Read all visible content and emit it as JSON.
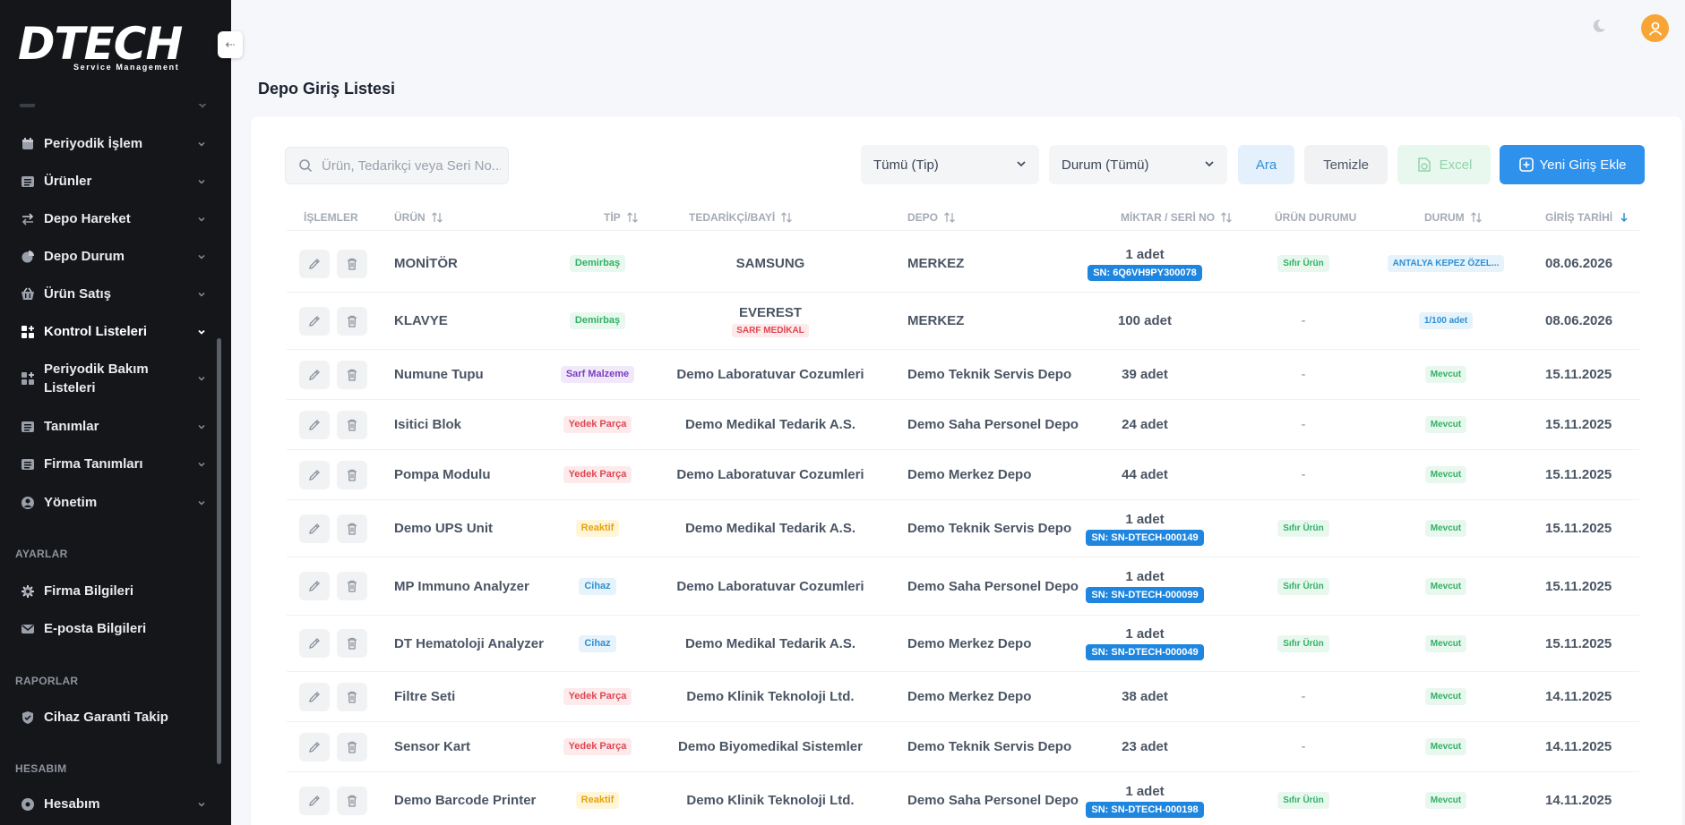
{
  "app": {
    "logo_text": "DTECH",
    "logo_subtitle": "Service Management",
    "collapse_icon": "arrow-left-icon"
  },
  "sidebar": {
    "items": [
      {
        "label": "Periyodik İşlem",
        "icon": "calendar-icon"
      },
      {
        "label": "Ürünler",
        "icon": "list-icon"
      },
      {
        "label": "Depo Hareket",
        "icon": "arrows-exchange-icon"
      },
      {
        "label": "Depo Durum",
        "icon": "pie-chart-icon"
      },
      {
        "label": "Ürün Satış",
        "icon": "basket-icon"
      },
      {
        "label": "Kontrol Listeleri",
        "icon": "grid-plus-icon"
      },
      {
        "label": "Periyodik Bakım Listeleri",
        "icon": "grid-plus-icon"
      },
      {
        "label": "Tanımlar",
        "icon": "list-icon"
      },
      {
        "label": "Firma Tanımları",
        "icon": "list-icon"
      },
      {
        "label": "Yönetim",
        "icon": "user-icon"
      }
    ],
    "section_settings": "AYARLAR",
    "settings_items": [
      {
        "label": "Firma Bilgileri",
        "icon": "gear-icon"
      },
      {
        "label": "E-posta Bilgileri",
        "icon": "mail-icon"
      }
    ],
    "section_reports": "RAPORLAR",
    "reports_items": [
      {
        "label": "Cihaz Garanti Takip",
        "icon": "shield-check-icon"
      }
    ],
    "section_account": "HESABIM",
    "account_items": [
      {
        "label": "Hesabım",
        "icon": "user-circle-icon"
      }
    ]
  },
  "header": {
    "theme_icon": "moon-icon",
    "avatar_icon": "user-avatar-icon"
  },
  "page": {
    "title": "Depo Giriş Listesi"
  },
  "toolbar": {
    "search_placeholder": "Ürün, Tedarikçi veya Seri No...",
    "type_select": "Tümü (Tip)",
    "status_select": "Durum (Tümü)",
    "search_button": "Ara",
    "clear_button": "Temizle",
    "excel_button": "Excel",
    "add_button": "Yeni Giriş Ekle"
  },
  "table": {
    "headers": {
      "actions": "İŞLEMLER",
      "product": "ÜRÜN",
      "type": "TİP",
      "supplier": "TEDARİKÇİ/BAYİ",
      "warehouse": "DEPO",
      "quantity": "MİKTAR / SERİ NO",
      "product_status": "ÜRÜN DURUMU",
      "status": "DURUM",
      "date": "GİRİŞ TARİHİ"
    },
    "rows": [
      {
        "product": "MONİTÖR",
        "type": "Demirbaş",
        "type_style": "demirbas",
        "supplier": "SAMSUNG",
        "supplier_sub": "",
        "warehouse": "MERKEZ",
        "quantity": "1 adet",
        "serial": "SN: 6Q6VH9PY300078",
        "product_status": "Sıfır Ürün",
        "status": "ANTALYA KEPEZ ÖZEL...",
        "status_style": "blue",
        "date": "08.06.2026"
      },
      {
        "product": "KLAVYE",
        "type": "Demirbaş",
        "type_style": "demirbas",
        "supplier": "EVEREST",
        "supplier_sub": "SARF MEDİKAL",
        "warehouse": "MERKEZ",
        "quantity": "100 adet",
        "serial": "",
        "product_status": "-",
        "status": "1/100 adet",
        "status_style": "blue",
        "date": "08.06.2026"
      },
      {
        "product": "Numune Tupu",
        "type": "Sarf Malzeme",
        "type_style": "sarf",
        "supplier": "Demo Laboratuvar Cozumleri",
        "supplier_sub": "",
        "warehouse": "Demo Teknik Servis Depo",
        "quantity": "39 adet",
        "serial": "",
        "product_status": "-",
        "status": "Mevcut",
        "status_style": "mevcut",
        "date": "15.11.2025"
      },
      {
        "product": "Isitici Blok",
        "type": "Yedek Parça",
        "type_style": "yedek",
        "supplier": "Demo Medikal Tedarik A.S.",
        "supplier_sub": "",
        "warehouse": "Demo Saha Personel Depo",
        "quantity": "24 adet",
        "serial": "",
        "product_status": "-",
        "status": "Mevcut",
        "status_style": "mevcut",
        "date": "15.11.2025"
      },
      {
        "product": "Pompa Modulu",
        "type": "Yedek Parça",
        "type_style": "yedek",
        "supplier": "Demo Laboratuvar Cozumleri",
        "supplier_sub": "",
        "warehouse": "Demo Merkez Depo",
        "quantity": "44 adet",
        "serial": "",
        "product_status": "-",
        "status": "Mevcut",
        "status_style": "mevcut",
        "date": "15.11.2025"
      },
      {
        "product": "Demo UPS Unit",
        "type": "Reaktif",
        "type_style": "reaktif",
        "supplier": "Demo Medikal Tedarik A.S.",
        "supplier_sub": "",
        "warehouse": "Demo Teknik Servis Depo",
        "quantity": "1 adet",
        "serial": "SN: SN-DTECH-000149",
        "product_status": "Sıfır Ürün",
        "status": "Mevcut",
        "status_style": "mevcut",
        "date": "15.11.2025"
      },
      {
        "product": "MP Immuno Analyzer",
        "type": "Cihaz",
        "type_style": "cihaz",
        "supplier": "Demo Laboratuvar Cozumleri",
        "supplier_sub": "",
        "warehouse": "Demo Saha Personel Depo",
        "quantity": "1 adet",
        "serial": "SN: SN-DTECH-000099",
        "product_status": "Sıfır Ürün",
        "status": "Mevcut",
        "status_style": "mevcut",
        "date": "15.11.2025"
      },
      {
        "product": "DT Hematoloji Analyzer",
        "type": "Cihaz",
        "type_style": "cihaz",
        "supplier": "Demo Medikal Tedarik A.S.",
        "supplier_sub": "",
        "warehouse": "Demo Merkez Depo",
        "quantity": "1 adet",
        "serial": "SN: SN-DTECH-000049",
        "product_status": "Sıfır Ürün",
        "status": "Mevcut",
        "status_style": "mevcut",
        "date": "15.11.2025"
      },
      {
        "product": "Filtre Seti",
        "type": "Yedek Parça",
        "type_style": "yedek",
        "supplier": "Demo Klinik Teknoloji Ltd.",
        "supplier_sub": "",
        "warehouse": "Demo Merkez Depo",
        "quantity": "38 adet",
        "serial": "",
        "product_status": "-",
        "status": "Mevcut",
        "status_style": "mevcut",
        "date": "14.11.2025"
      },
      {
        "product": "Sensor Kart",
        "type": "Yedek Parça",
        "type_style": "yedek",
        "supplier": "Demo Biyomedikal Sistemler",
        "supplier_sub": "",
        "warehouse": "Demo Teknik Servis Depo",
        "quantity": "23 adet",
        "serial": "",
        "product_status": "-",
        "status": "Mevcut",
        "status_style": "mevcut",
        "date": "14.11.2025"
      },
      {
        "product": "Demo Barcode Printer",
        "type": "Reaktif",
        "type_style": "reaktif",
        "supplier": "Demo Klinik Teknoloji Ltd.",
        "supplier_sub": "",
        "warehouse": "Demo Saha Personel Depo",
        "quantity": "1 adet",
        "serial": "SN: SN-DTECH-000198",
        "product_status": "Sıfır Ürün",
        "status": "Mevcut",
        "status_style": "mevcut",
        "date": "14.11.2025"
      }
    ]
  },
  "colors": {
    "sidebar_bg": "#14161a",
    "primary": "#1f86e0",
    "avatar": "#f7a534"
  }
}
